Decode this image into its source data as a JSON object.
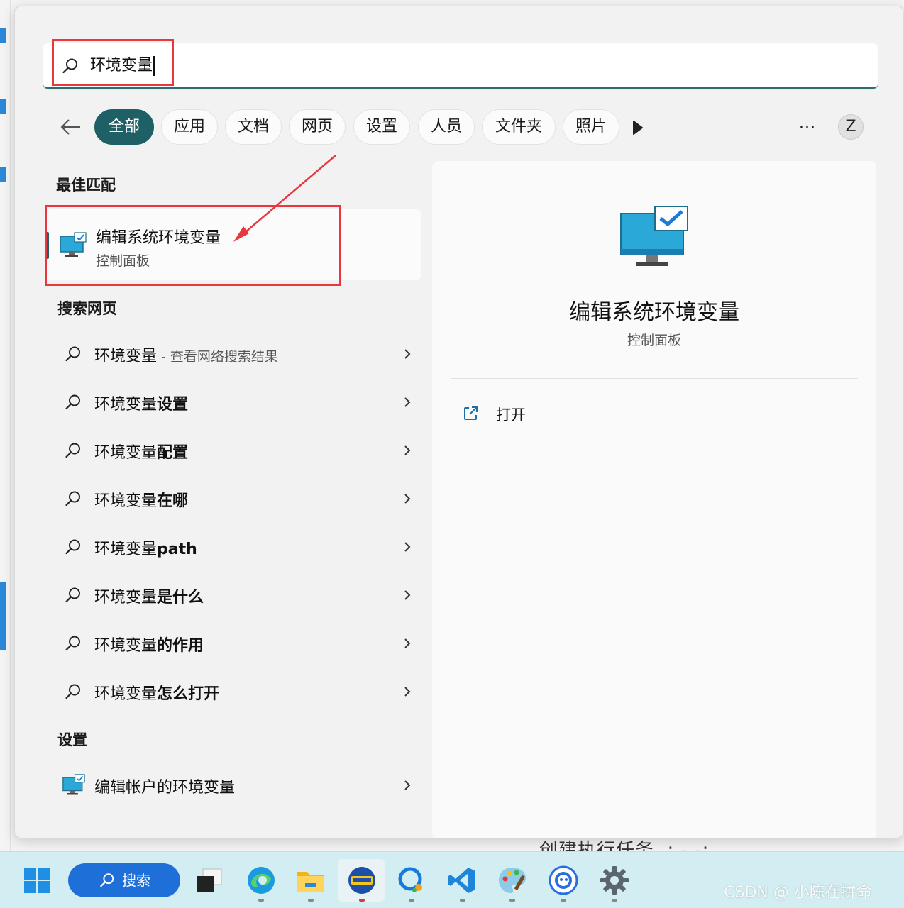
{
  "search": {
    "query": "环境变量"
  },
  "filters": {
    "chips": [
      "全部",
      "应用",
      "文档",
      "网页",
      "设置",
      "人员",
      "文件夹",
      "照片"
    ],
    "active_index": 0,
    "more_label": "...",
    "avatar_letter": "Z"
  },
  "best_match": {
    "heading": "最佳匹配",
    "title": "编辑系统环境变量",
    "subtitle": "控制面板"
  },
  "web_search": {
    "heading": "搜索网页",
    "items": [
      {
        "prefix": "环境变量",
        "bold": "",
        "sep": "-",
        "extra": "查看网络搜索结果"
      },
      {
        "prefix": "环境变量",
        "bold": "设置",
        "sep": "",
        "extra": ""
      },
      {
        "prefix": "环境变量",
        "bold": "配置",
        "sep": "",
        "extra": ""
      },
      {
        "prefix": "环境变量",
        "bold": "在哪",
        "sep": "",
        "extra": ""
      },
      {
        "prefix": "环境变量",
        "bold": "path",
        "sep": "",
        "extra": ""
      },
      {
        "prefix": "环境变量",
        "bold": "是什么",
        "sep": "",
        "extra": ""
      },
      {
        "prefix": "环境变量",
        "bold": "的作用",
        "sep": "",
        "extra": ""
      },
      {
        "prefix": "环境变量",
        "bold": "怎么打开",
        "sep": "",
        "extra": ""
      }
    ]
  },
  "settings": {
    "heading": "设置",
    "item": "编辑帐户的环境变量"
  },
  "preview": {
    "title": "编辑系统环境变量",
    "subtitle": "控制面板",
    "action_open": "打开"
  },
  "taskbar": {
    "search_label": "搜索"
  },
  "background": {
    "partial_text": "创建执行任务 .: - -:"
  },
  "watermark": "CSDN @  小陈在拼命",
  "colors": {
    "accent": "#1f5f66",
    "annotation": "#e8383d",
    "taskbar": "#d3eef2",
    "search_pill": "#1e6fd8"
  }
}
